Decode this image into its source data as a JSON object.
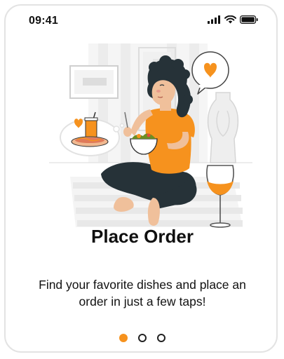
{
  "status_bar": {
    "time": "09:41",
    "icons": [
      "signal-icon",
      "wifi-icon",
      "battery-icon"
    ]
  },
  "illustration": {
    "name": "woman-eating-salad-illustration"
  },
  "onboarding": {
    "title": "Place Order",
    "description": "Find your favorite dishes and place an order in just a few taps!"
  },
  "pagination": {
    "total": 3,
    "active_index": 0
  },
  "colors": {
    "accent": "#f6921e",
    "text": "#111111",
    "frame_border": "#e3e3e3",
    "illustration_gray": "#eeeeee"
  }
}
